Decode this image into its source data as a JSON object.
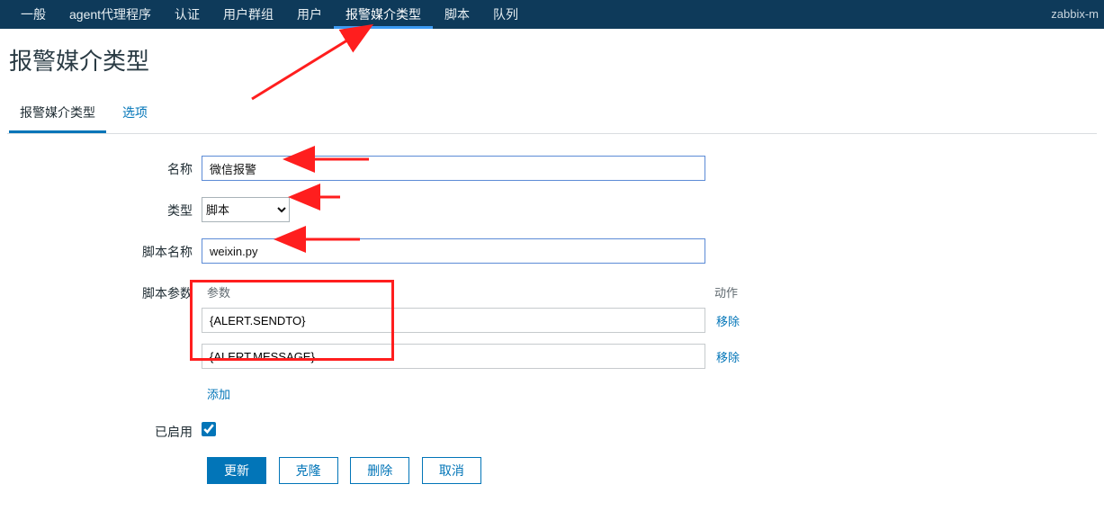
{
  "nav": {
    "items": [
      "一般",
      "agent代理程序",
      "认证",
      "用户群组",
      "用户",
      "报警媒介类型",
      "脚本",
      "队列"
    ],
    "active_index": 5,
    "right": "zabbix-m"
  },
  "page_title": "报警媒介类型",
  "subtabs": {
    "items": [
      "报警媒介类型",
      "选项"
    ],
    "active_index": 0
  },
  "form": {
    "name_label": "名称",
    "name_value": "微信报警",
    "type_label": "类型",
    "type_value": "脚本",
    "script_name_label": "脚本名称",
    "script_name_value": "weixin.py",
    "script_params_label": "脚本参数",
    "params_head_param": "参数",
    "params_head_action": "动作",
    "params": [
      {
        "value": "{ALERT.SENDTO}"
      },
      {
        "value": "{ALERT.MESSAGE}"
      }
    ],
    "remove_label": "移除",
    "add_label": "添加",
    "enabled_label": "已启用",
    "enabled_checked": true
  },
  "buttons": {
    "update": "更新",
    "clone": "克隆",
    "delete": "删除",
    "cancel": "取消"
  }
}
